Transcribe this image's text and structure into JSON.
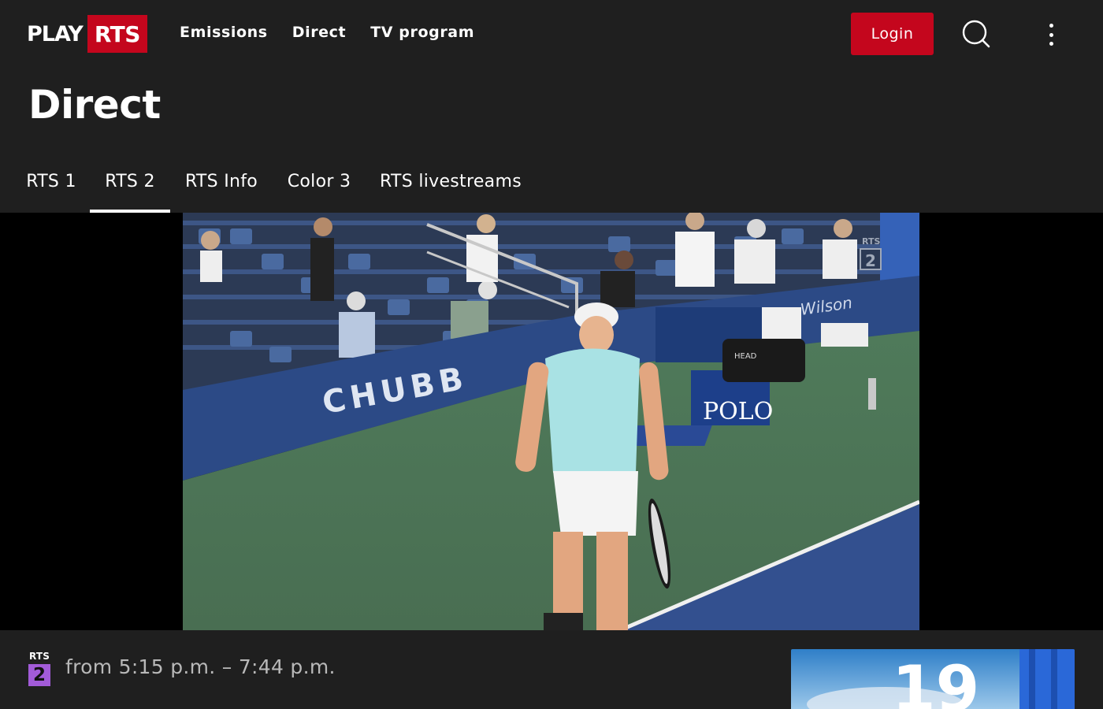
{
  "header": {
    "logo_play": "PLAY",
    "logo_rts": "RTS",
    "nav": [
      "Emissions",
      "Direct",
      "TV program"
    ],
    "login_label": "Login",
    "search_icon": "search-icon",
    "more_icon": "more-vertical-icon"
  },
  "page": {
    "title": "Direct"
  },
  "tabs": [
    {
      "label": "RTS 1",
      "active": false
    },
    {
      "label": "RTS 2",
      "active": true
    },
    {
      "label": "RTS Info",
      "active": false
    },
    {
      "label": "Color 3",
      "active": false
    },
    {
      "label": "RTS livestreams",
      "active": false
    }
  ],
  "player": {
    "watermark_brand": "RTS",
    "watermark_num": "2",
    "signage_chubb": "CHUBB",
    "signage_polo": "POLO",
    "signage_wilson": "Wilson",
    "bag_brand": "HEAD"
  },
  "program": {
    "channel_brand": "RTS",
    "channel_num": "2",
    "time_range": "from 5:15 p.m. – 7:44 p.m.",
    "thumb_number": "19"
  },
  "colors": {
    "accent_red": "#c4061d",
    "rts2_purple": "#a25bd8",
    "background": "#1f1f1f"
  }
}
